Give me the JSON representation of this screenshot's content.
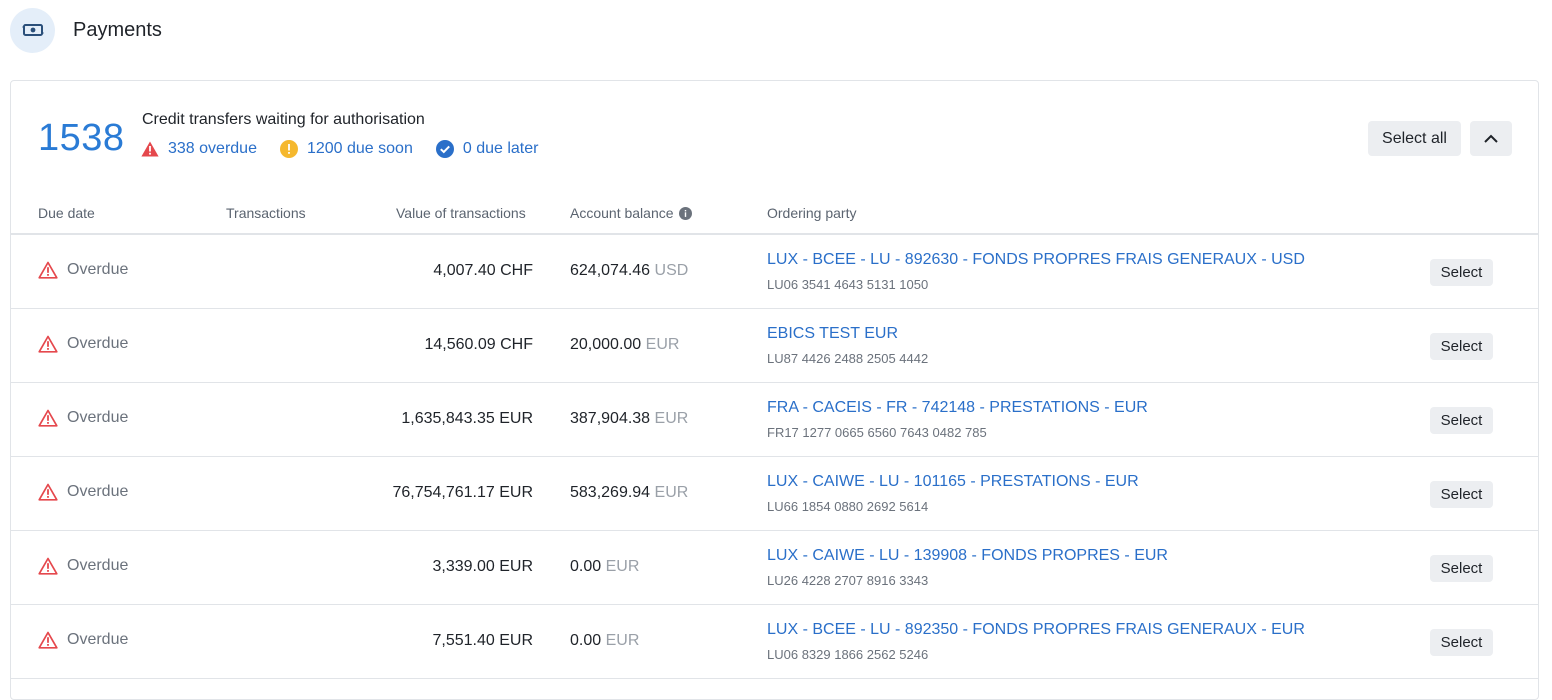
{
  "header": {
    "title": "Payments",
    "icon": "money-transfer-icon"
  },
  "summary": {
    "count": "1538",
    "title": "Credit transfers waiting for authorisation",
    "overdue": "338 overdue",
    "due_soon": "1200 due soon",
    "due_later": "0 due later",
    "select_all_label": "Select all"
  },
  "colors": {
    "accent": "#2a7bd5",
    "overdue": "#e5484d",
    "due_soon": "#f5b82e",
    "due_later": "#2a6fc9"
  },
  "columns": {
    "due_date": "Due date",
    "transactions": "Transactions",
    "value": "Value of transactions",
    "balance": "Account balance",
    "ordering_party": "Ordering party"
  },
  "rows": [
    {
      "status": "Overdue",
      "transactions": "",
      "value": "4,007.40 CHF",
      "balance": "624,074.46",
      "balance_currency": "USD",
      "party_name": "LUX - BCEE - LU - 892630 - FONDS PROPRES FRAIS GENERAUX - USD",
      "party_iban": "LU06 3541 4643 5131 1050",
      "select_label": "Select"
    },
    {
      "status": "Overdue",
      "transactions": "",
      "value": "14,560.09 CHF",
      "balance": "20,000.00",
      "balance_currency": "EUR",
      "party_name": "EBICS TEST EUR",
      "party_iban": "LU87 4426 2488 2505 4442",
      "select_label": "Select"
    },
    {
      "status": "Overdue",
      "transactions": "",
      "value": "1,635,843.35 EUR",
      "balance": "387,904.38",
      "balance_currency": "EUR",
      "party_name": "FRA - CACEIS - FR - 742148 - PRESTATIONS - EUR",
      "party_iban": "FR17 1277 0665 6560 7643 0482 785",
      "select_label": "Select"
    },
    {
      "status": "Overdue",
      "transactions": "",
      "value": "76,754,761.17 EUR",
      "balance": "583,269.94",
      "balance_currency": "EUR",
      "party_name": "LUX - CAIWE - LU - 101165 - PRESTATIONS - EUR",
      "party_iban": "LU66 1854 0880 2692 5614",
      "select_label": "Select"
    },
    {
      "status": "Overdue",
      "transactions": "",
      "value": "3,339.00 EUR",
      "balance": "0.00",
      "balance_currency": "EUR",
      "party_name": "LUX - CAIWE - LU - 139908 - FONDS PROPRES - EUR",
      "party_iban": "LU26 4228 2707 8916 3343",
      "select_label": "Select"
    },
    {
      "status": "Overdue",
      "transactions": "",
      "value": "7,551.40 EUR",
      "balance": "0.00",
      "balance_currency": "EUR",
      "party_name": "LUX - BCEE - LU - 892350 - FONDS PROPRES FRAIS GENERAUX - EUR",
      "party_iban": "LU06 8329 1866 2562 5246",
      "select_label": "Select"
    }
  ]
}
